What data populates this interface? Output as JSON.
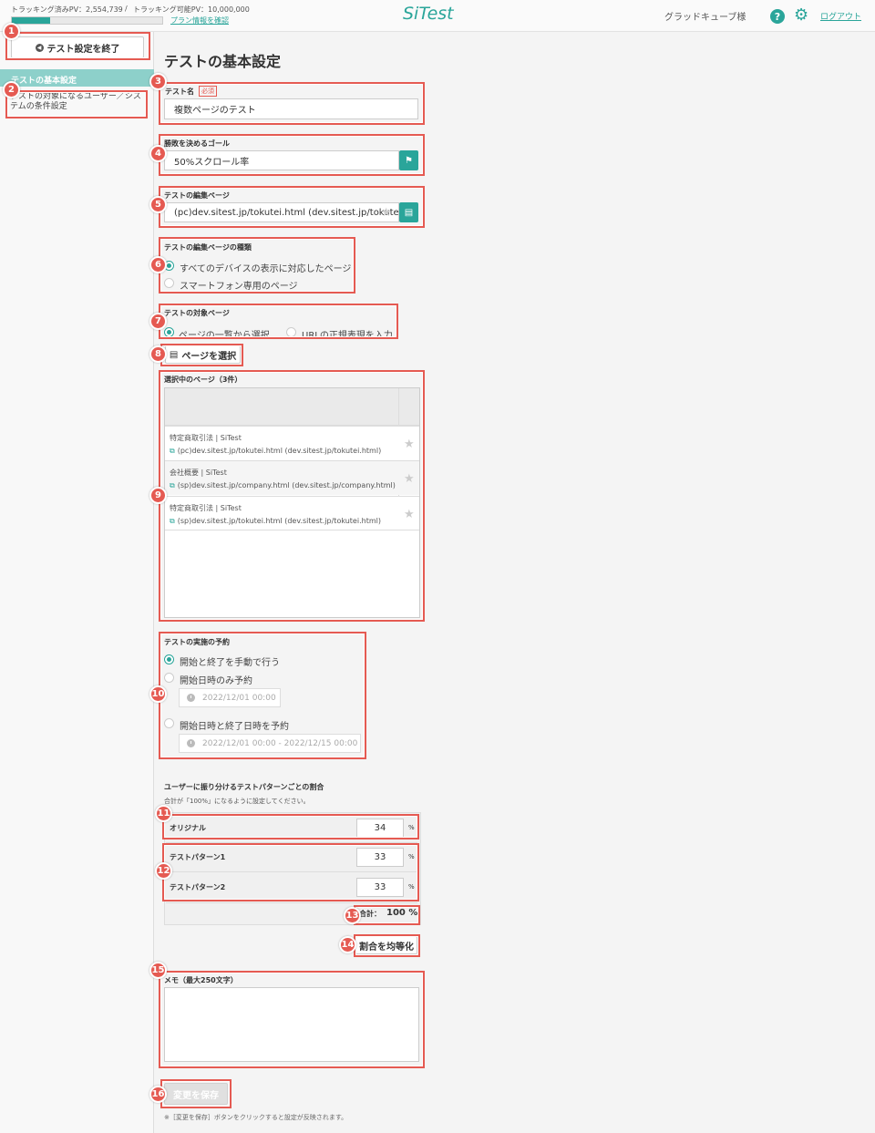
{
  "header": {
    "tracked_pv": "トラッキング済みPV：2,554,739",
    "separator": "/",
    "trackable_pv": "トラッキング可能PV：10,000,000",
    "plan_link": "プラン情報を確認",
    "logo": "SiTest",
    "user": "グラッドキューブ様",
    "logout": "ログアウト",
    "usage_progress": 0.255
  },
  "sidebar": {
    "end_button": "テスト設定を終了",
    "items": [
      {
        "label": "テストの基本設定",
        "active": true
      },
      {
        "label": "テストの対象になるユーザー／システムの条件設定",
        "active": false
      }
    ]
  },
  "main": {
    "page_title": "テストの基本設定",
    "test_name": {
      "label": "テスト名",
      "required": "必須",
      "value": "複数ページのテスト"
    },
    "goal": {
      "label": "勝敗を決めるゴール",
      "value": "50%スクロール率"
    },
    "edit_page": {
      "label": "テストの編集ページ",
      "value": "(pc)dev.sitest.jp/tokutei.html (dev.sitest.jp/tokutei."
    },
    "page_type": {
      "label": "テストの編集ページの種類",
      "options": [
        "すべてのデバイスの表示に対応したページ",
        "スマートフォン専用のページ"
      ],
      "selected": 0
    },
    "target_page": {
      "label": "テストの対象ページ",
      "options": [
        "ページの一覧から選択",
        "URLの正規表現を入力"
      ],
      "selected": 0
    },
    "select_pages_button": "ページを選択",
    "selected_pages": {
      "label": "選択中のページ（3件）",
      "rows": [
        {
          "name": "特定商取引法 | SiTest",
          "url": "(pc)dev.sitest.jp/tokutei.html (dev.sitest.jp/tokutei.html)"
        },
        {
          "name": "会社概要 | SiTest",
          "url": "(sp)dev.sitest.jp/company.html (dev.sitest.jp/company.html)"
        },
        {
          "name": "特定商取引法 | SiTest",
          "url": "(sp)dev.sitest.jp/tokutei.html (dev.sitest.jp/tokutei.html)"
        }
      ]
    },
    "schedule": {
      "label": "テストの実施の予約",
      "options": [
        "開始と終了を手動で行う",
        "開始日時のみ予約",
        "開始日時と終了日時を予約"
      ],
      "selected": 0,
      "start_placeholder": "2022/12/01 00:00",
      "range_placeholder": "2022/12/01 00:00 - 2022/12/15 00:00"
    },
    "ratio": {
      "title": "ユーザーに振り分けるテストパターンごとの割合",
      "note": "合計が「100%」になるように設定してください。",
      "rows": [
        {
          "label": "オリジナル",
          "value": "34"
        },
        {
          "label": "テストパターン1",
          "value": "33"
        },
        {
          "label": "テストパターン2",
          "value": "33"
        }
      ],
      "unit": "%",
      "total_label": "合計：",
      "total_value": "100 %",
      "equalize_button": "割合を均等化"
    },
    "memo": {
      "label": "メモ（最大250文字）",
      "value": ""
    },
    "save_button": "変更を保存",
    "save_note": "※［変更を保存］ボタンをクリックすると設定が反映されます。"
  },
  "badges": [
    "1",
    "2",
    "3",
    "4",
    "5",
    "6",
    "7",
    "8",
    "9",
    "10",
    "11",
    "12",
    "13",
    "14",
    "15",
    "16"
  ],
  "colors": {
    "accent": "#2aa59a",
    "highlight": "#e55a52",
    "sidebar_active": "#8dd0ca"
  }
}
